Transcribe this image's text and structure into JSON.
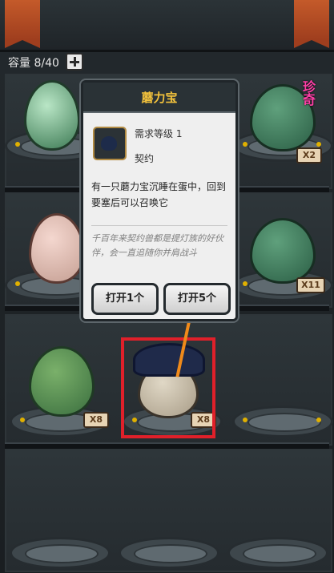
{
  "header": {
    "capacity_label": "容量 8/40"
  },
  "popup": {
    "title": "蘑力宝",
    "required_level": "需求等级 1",
    "contract_label": "契约",
    "description": "有一只蘑力宝沉睡在蛋中，回到要塞后可以召唤它",
    "lore": "千百年来契约兽都是提灯族的好伙伴，会一直追随你并肩战斗",
    "open_one_label": "打开1个",
    "open_five_label": "打开5个"
  },
  "shelf": {
    "tags": [
      {
        "text": "X2"
      },
      {
        "text": "X11"
      },
      {
        "text": "X8"
      },
      {
        "text": "X8"
      }
    ],
    "rare_label": "珍奇"
  },
  "colors": {
    "accent_gold": "#f3c23c",
    "highlight_red": "#e0202a",
    "arrow_orange": "#f08a1a"
  }
}
